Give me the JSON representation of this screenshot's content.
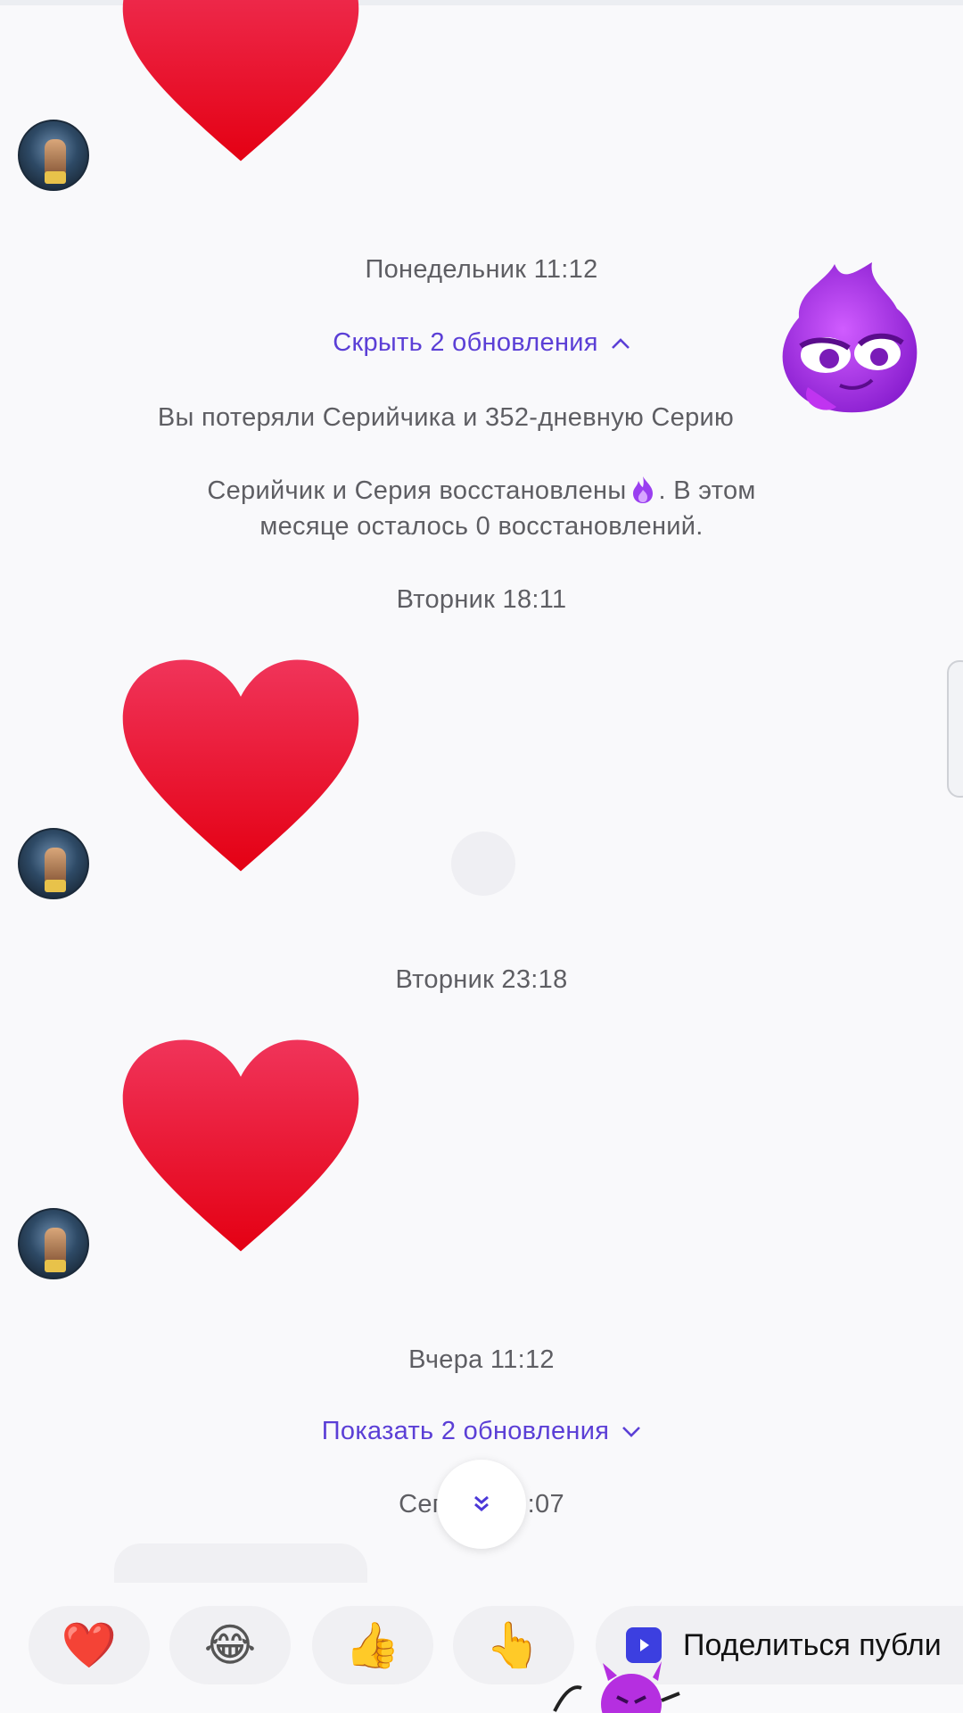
{
  "messages": [
    {
      "type": "heart"
    },
    {
      "type": "heart"
    },
    {
      "type": "heart"
    }
  ],
  "timestamps": {
    "monday": "Понедельник 11:12",
    "tuesday_1": "Вторник 18:11",
    "tuesday_2": "Вторник 23:18",
    "yesterday": "Вчера 11:12",
    "today_left": "Сег",
    "today_right": ":07"
  },
  "updates": {
    "hide_label": "Скрыть 2 обновления",
    "show_label": "Показать 2 обновления"
  },
  "system": {
    "lost_streak": "Вы потеряли Серийчика и 352-дневную Серию",
    "restored_part1": "Серийчик и Серия восстановлены",
    "restored_part2": ". В этом",
    "restored_line2": "месяце осталось 0 восстановлений."
  },
  "reactions": [
    {
      "name": "heart",
      "glyph": "❤️"
    },
    {
      "name": "laugh",
      "glyph": "😂"
    },
    {
      "name": "thumbs-up",
      "glyph": "👍"
    },
    {
      "name": "point",
      "glyph": "👆"
    }
  ],
  "share": {
    "label": "Поделиться публи"
  },
  "colors": {
    "accent": "#5b3fd6",
    "heart": "#e8112d",
    "background": "#f9f9fb"
  },
  "icons": [
    "heart-icon",
    "fire-icon",
    "chevron-up-icon",
    "chevron-down-icon",
    "double-chevron-down-icon",
    "share-icon",
    "mascot-icon",
    "devil-icon"
  ]
}
